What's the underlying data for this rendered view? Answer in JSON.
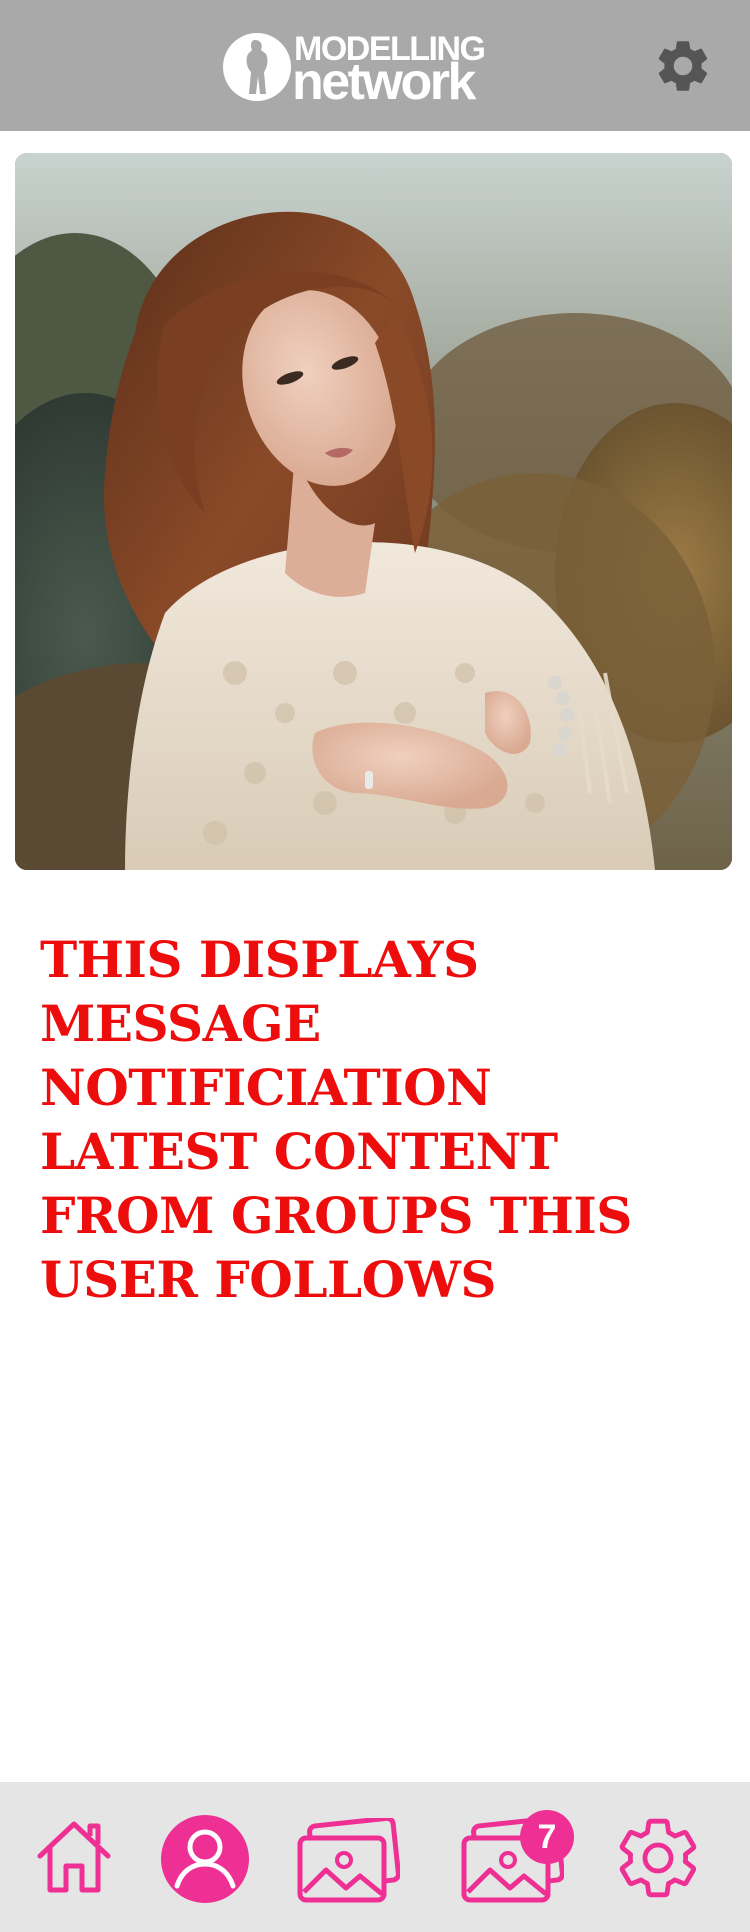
{
  "header": {
    "logo_line1": "MODELLING",
    "logo_line2": "network",
    "settings_icon": "gear-icon"
  },
  "hero": {
    "icon": "photo-model-portrait"
  },
  "message": {
    "text": "THIS DISPLAYS MESSAGE NOTIFICIATION LATEST CONTENT FROM GROUPS THIS USER FOLLOWS"
  },
  "bottom_nav": {
    "items": [
      {
        "id": "home",
        "icon": "home-icon"
      },
      {
        "id": "profile",
        "icon": "user-circle-icon"
      },
      {
        "id": "gallery",
        "icon": "photos-icon"
      },
      {
        "id": "notifications",
        "icon": "photos-icon",
        "badge": "7"
      },
      {
        "id": "settings",
        "icon": "gear-icon"
      }
    ]
  },
  "colors": {
    "header_bg": "#a9a9a9",
    "accent_pink": "#ee2f93",
    "message_red": "#ee0d0d",
    "nav_bg": "#e5e5e5",
    "header_gear": "#555555"
  }
}
